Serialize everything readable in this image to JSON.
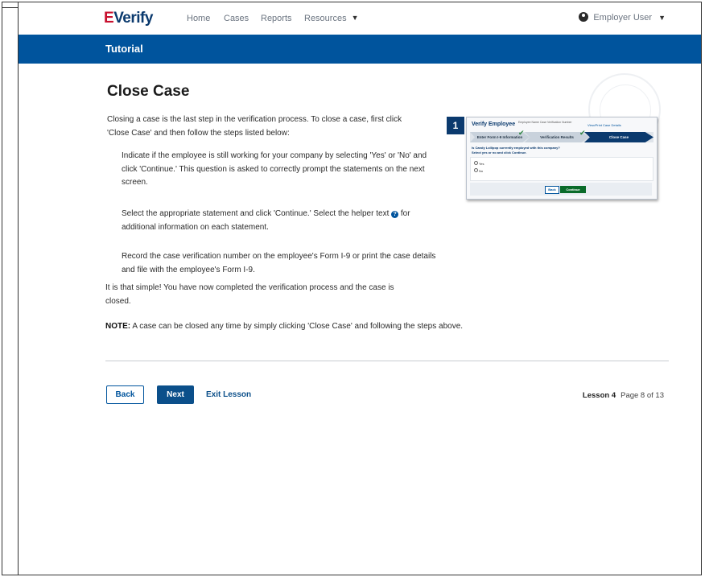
{
  "header": {
    "logo_e": "E",
    "logo_text": "Verify",
    "nav": [
      "Home",
      "Cases",
      "Reports",
      "Resources"
    ],
    "user": "Employer User"
  },
  "banner": {
    "title": "Tutorial"
  },
  "main": {
    "title": "Close Case",
    "intro": "Closing a case is the last step in the verification process. To close a case, first click 'Close Case' and then follow the steps listed below:",
    "step1": "Indicate if the employee is still working for your company by selecting 'Yes' or 'No' and click 'Continue.' This question is asked to correctly prompt the statements on the next screen.",
    "step2_a": "Select the appropriate statement and click 'Continue.' Select the helper text",
    "step2_b": "for additional information on each statement.",
    "step3": "Record the case verification number on the employee's Form I-9 or print the case details and file with the employee's Form I-9.",
    "done": "It is that simple! You have now completed the verification process and the case is closed.",
    "note_label": "NOTE:",
    "note_text": "A case can be closed any time by simply clicking 'Close Case' and following the steps above."
  },
  "thumbnail": {
    "step_number": "1",
    "title": "Verify Employee",
    "meta": "Employee Name  Case Verification Number",
    "link": "View/Print Case Details",
    "steps": [
      "Enter Form I-9 Information",
      "Verification Results",
      "Close Case"
    ],
    "question": "Is Candy Lollipop currently employed with this company?",
    "instruction": "Select yes or no and click Continue.",
    "radio_yes": "Yes",
    "radio_no": "No",
    "back": "Back",
    "continue": "Continue"
  },
  "footer": {
    "back": "Back",
    "next": "Next",
    "exit": "Exit Lesson",
    "lesson": "Lesson 4",
    "page": "Page 8 of 13"
  },
  "colors": {
    "brand_blue": "#00549d",
    "brand_red": "#c8102e",
    "continue_green": "#0a6b2a"
  }
}
